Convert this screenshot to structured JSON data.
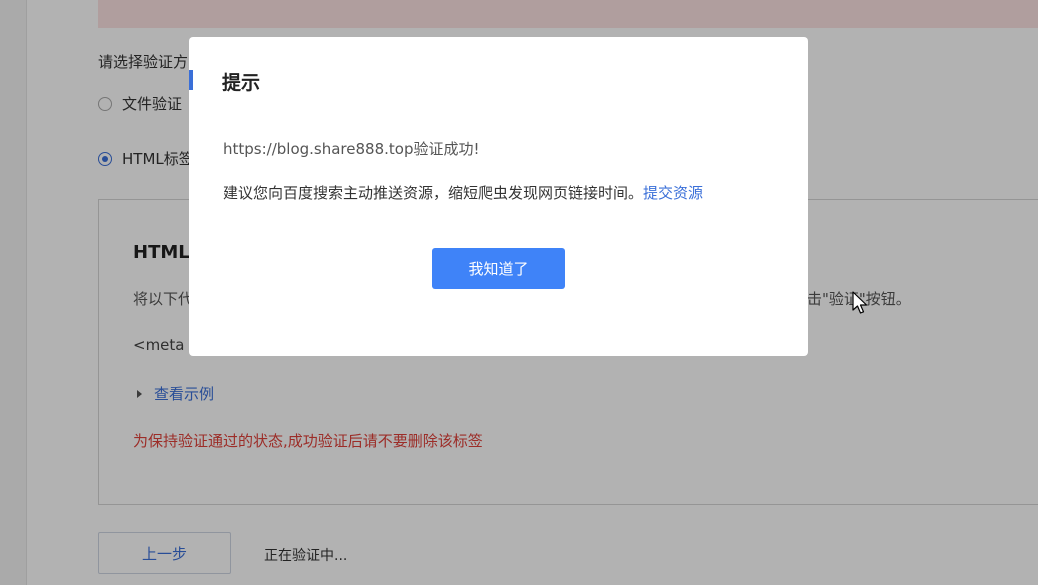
{
  "background": {
    "choose_label": "请选择验证方",
    "radio_file_label": "文件验证",
    "radio_html_label": "HTML标签",
    "panel": {
      "title": "HTML标",
      "desc_prefix": "将以下代",
      "desc_suffix": "击\"验证\"按钮。",
      "code_snippet": "<meta n",
      "example_label": "查看示例",
      "warning": "为保持验证通过的状态,成功验证后请不要删除该标签"
    },
    "prev_button_label": "上一步",
    "status_text": "正在验证中..."
  },
  "modal": {
    "title": "提示",
    "line1": "https://blog.share888.top验证成功!",
    "line2": "建议您向百度搜索主动推送资源，缩短爬虫发现网页链接时间。",
    "link_label": "提交资源",
    "ok_button_label": "我知道了"
  },
  "colors": {
    "accent": "#3a6fd8",
    "primary_button": "#3f83f8",
    "warning": "#e0413a"
  }
}
